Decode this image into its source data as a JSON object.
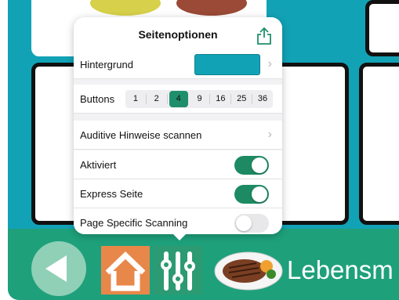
{
  "popover": {
    "title": "Seitenoptionen",
    "share_icon": "share-icon",
    "rows": {
      "background_label": "Hintergrund",
      "background_color": "#12a2b6",
      "buttons_label": "Buttons",
      "button_options": [
        "1",
        "2",
        "4",
        "9",
        "16",
        "25",
        "36"
      ],
      "button_selected": "4",
      "audio_label": "Auditive Hinweise scannen",
      "activated_label": "Aktiviert",
      "activated_on": true,
      "express_label": "Express Seite",
      "express_on": true,
      "page_scanning_label": "Page Specific Scanning",
      "page_scanning_on": false
    }
  },
  "bottom_bar": {
    "food_label": "Lebensm"
  },
  "colors": {
    "teal_background": "#12a2b6",
    "bottom_bar": "#1ea07b",
    "toggle_on": "#1d8a63",
    "home_button": "#e8874a"
  }
}
